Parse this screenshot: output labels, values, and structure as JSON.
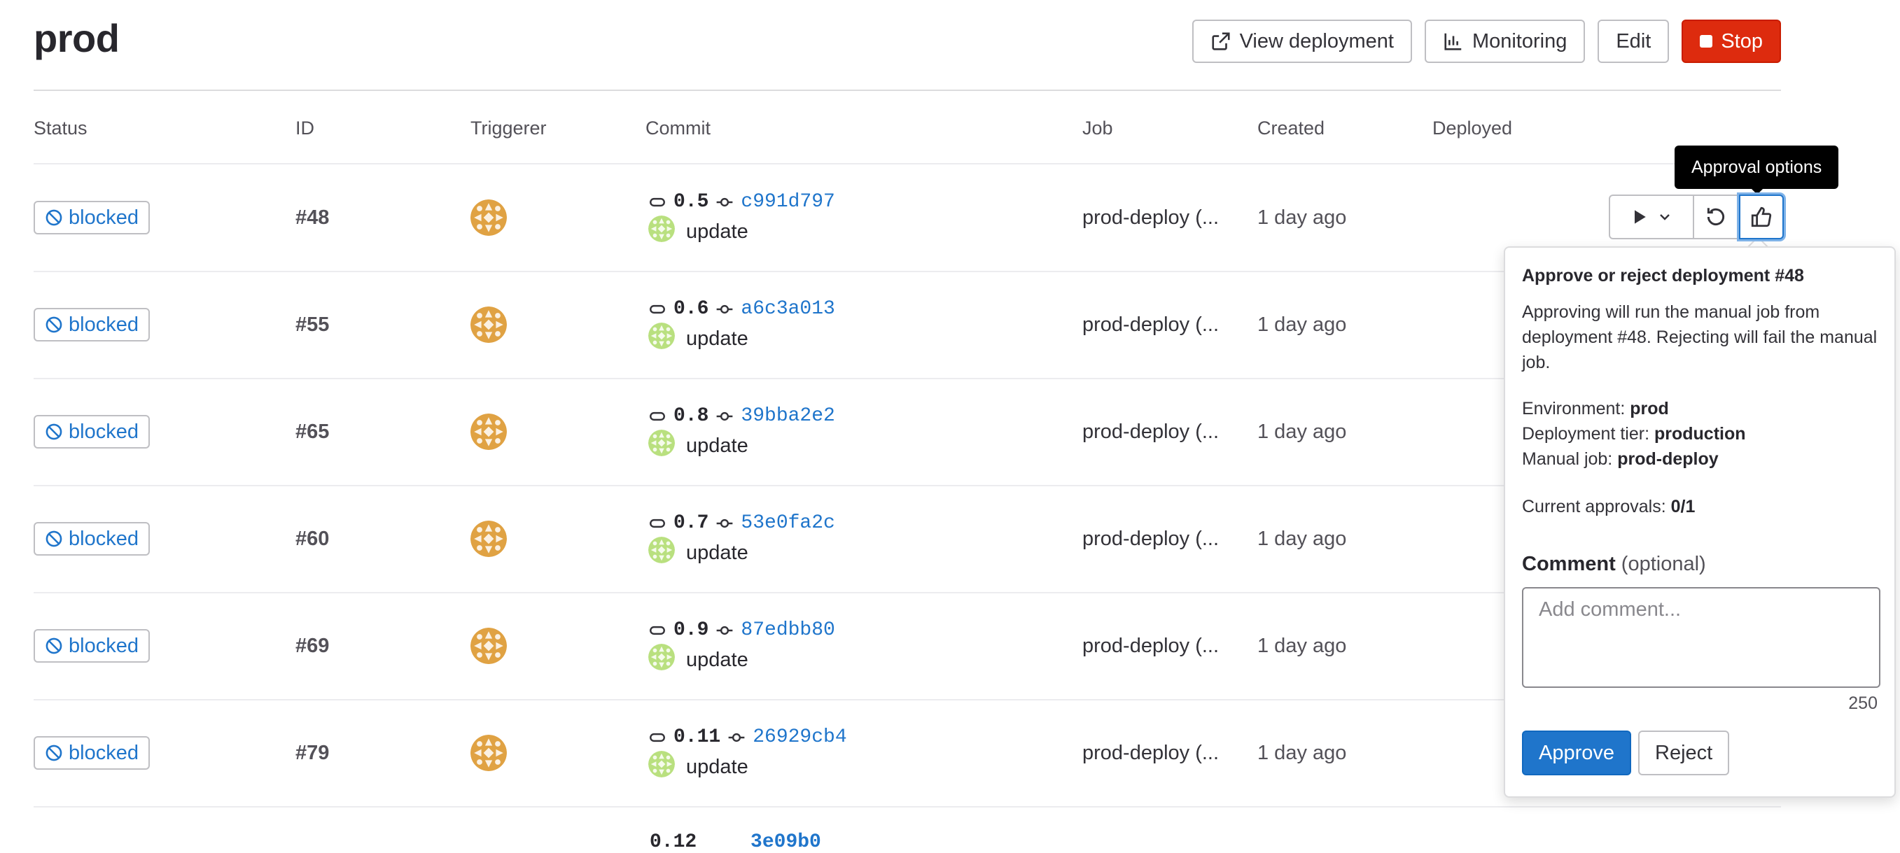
{
  "page": {
    "title": "prod"
  },
  "header": {
    "view_deployment": "View deployment",
    "monitoring": "Monitoring",
    "edit": "Edit",
    "stop": "Stop"
  },
  "columns": [
    "Status",
    "ID",
    "Triggerer",
    "Commit",
    "Job",
    "Created",
    "Deployed"
  ],
  "colors": {
    "link": "#1f75cb",
    "danger": "#dd2b0e",
    "avatar_triggerer": "#e0a243",
    "avatar_commit": "#b9e07f"
  },
  "rows": [
    {
      "status": "blocked",
      "id": "#48",
      "ref": "0.5",
      "sha": "c991d797",
      "title": "update",
      "job": "prod-deploy (...",
      "created": "1 day ago"
    },
    {
      "status": "blocked",
      "id": "#55",
      "ref": "0.6",
      "sha": "a6c3a013",
      "title": "update",
      "job": "prod-deploy (...",
      "created": "1 day ago"
    },
    {
      "status": "blocked",
      "id": "#65",
      "ref": "0.8",
      "sha": "39bba2e2",
      "title": "update",
      "job": "prod-deploy (...",
      "created": "1 day ago"
    },
    {
      "status": "blocked",
      "id": "#60",
      "ref": "0.7",
      "sha": "53e0fa2c",
      "title": "update",
      "job": "prod-deploy (...",
      "created": "1 day ago"
    },
    {
      "status": "blocked",
      "id": "#69",
      "ref": "0.9",
      "sha": "87edbb80",
      "title": "update",
      "job": "prod-deploy (...",
      "created": "1 day ago"
    },
    {
      "status": "blocked",
      "id": "#79",
      "ref": "0.11",
      "sha": "26929cb4",
      "title": "update",
      "job": "prod-deploy (...",
      "created": "1 day ago"
    }
  ],
  "tooltip": "Approval options",
  "popover": {
    "title": "Approve or reject deployment #48",
    "description": "Approving will run the manual job from deployment #48. Rejecting will fail the manual job.",
    "environment_label": "Environment:",
    "environment": "prod",
    "tier_label": "Deployment tier:",
    "tier": "production",
    "job_label": "Manual job:",
    "job": "prod-deploy",
    "approvals_label": "Current approvals:",
    "approvals": "0/1",
    "comment_label": "Comment",
    "comment_optional": "(optional)",
    "comment_placeholder": "Add comment...",
    "char_count": "250",
    "approve": "Approve",
    "reject": "Reject"
  }
}
